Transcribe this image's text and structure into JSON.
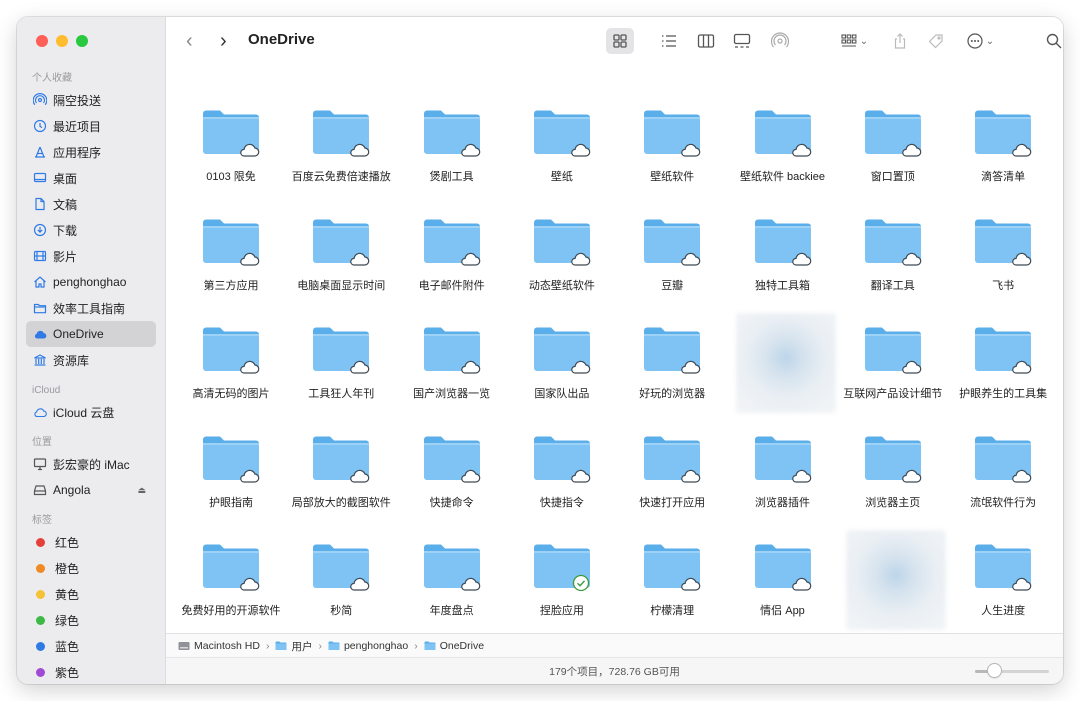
{
  "window": {
    "title": "OneDrive"
  },
  "sidebar": {
    "sections": [
      {
        "heading": "个人收藏",
        "items": [
          {
            "label": "隔空投送",
            "icon": "airdrop-icon"
          },
          {
            "label": "最近项目",
            "icon": "clock-icon"
          },
          {
            "label": "应用程序",
            "icon": "applications-icon"
          },
          {
            "label": "桌面",
            "icon": "desktop-icon"
          },
          {
            "label": "文稿",
            "icon": "document-icon"
          },
          {
            "label": "下载",
            "icon": "download-icon"
          },
          {
            "label": "影片",
            "icon": "film-icon"
          },
          {
            "label": "penghonghao",
            "icon": "home-icon"
          },
          {
            "label": "效率工具指南",
            "icon": "folder-icon"
          },
          {
            "label": "OneDrive",
            "icon": "cloud-icon",
            "selected": true
          },
          {
            "label": "资源库",
            "icon": "library-icon"
          }
        ]
      },
      {
        "heading": "iCloud",
        "items": [
          {
            "label": "iCloud 云盘",
            "icon": "icloud-icon"
          }
        ]
      },
      {
        "heading": "位置",
        "items": [
          {
            "label": "彭宏豪的 iMac",
            "icon": "imac-icon"
          },
          {
            "label": "Angola",
            "icon": "drive-icon",
            "eject": "⏏"
          }
        ]
      },
      {
        "heading": "标签",
        "items": [
          {
            "label": "红色",
            "color": "#e5413a"
          },
          {
            "label": "橙色",
            "color": "#f08a24"
          },
          {
            "label": "黄色",
            "color": "#f4c234"
          },
          {
            "label": "绿色",
            "color": "#3dba45"
          },
          {
            "label": "蓝色",
            "color": "#2f7ae5"
          },
          {
            "label": "紫色",
            "color": "#a04bd6"
          }
        ]
      }
    ]
  },
  "toolbar": {
    "back_glyph": "‹",
    "forward_glyph": "›",
    "buttons": [
      "icon-view-button",
      "list-view-button",
      "column-view-button",
      "gallery-view-button",
      "airdrop-button",
      "group-button",
      "share-button",
      "tag-button",
      "more-button",
      "search-button"
    ]
  },
  "items": [
    {
      "label": "0103 限免",
      "status": "cloud"
    },
    {
      "label": "百度云免费倍速播放",
      "status": "cloud"
    },
    {
      "label": "煲剧工具",
      "status": "cloud"
    },
    {
      "label": "壁纸",
      "status": "cloud"
    },
    {
      "label": "壁纸软件",
      "status": "cloud"
    },
    {
      "label": "壁纸软件 backiee",
      "status": "cloud"
    },
    {
      "label": "窗口置顶",
      "status": "cloud"
    },
    {
      "label": "滴答清单",
      "status": "cloud"
    },
    {
      "label": "第三方应用",
      "status": "cloud"
    },
    {
      "label": "电脑桌面显示时间",
      "status": "cloud"
    },
    {
      "label": "电子邮件附件",
      "status": "cloud"
    },
    {
      "label": "动态壁纸软件",
      "status": "cloud"
    },
    {
      "label": "豆瓣",
      "status": "cloud"
    },
    {
      "label": "独特工具箱",
      "status": "cloud"
    },
    {
      "label": "翻译工具",
      "status": "cloud"
    },
    {
      "label": "飞书",
      "status": "cloud"
    },
    {
      "label": "高清无码的图片",
      "status": "cloud"
    },
    {
      "label": "工具狂人年刊",
      "status": "cloud"
    },
    {
      "label": "国产浏览器一览",
      "status": "cloud"
    },
    {
      "label": "国家队出品",
      "status": "cloud"
    },
    {
      "label": "好玩的浏览器",
      "status": "cloud"
    },
    {
      "label": "",
      "status": "blurred"
    },
    {
      "label": "互联网产品设计细节",
      "status": "cloud"
    },
    {
      "label": "护眼养生的工具集",
      "status": "cloud"
    },
    {
      "label": "护眼指南",
      "status": "cloud"
    },
    {
      "label": "局部放大的截图软件",
      "status": "cloud"
    },
    {
      "label": "快捷命令",
      "status": "cloud"
    },
    {
      "label": "快捷指令",
      "status": "cloud"
    },
    {
      "label": "快速打开应用",
      "status": "cloud"
    },
    {
      "label": "浏览器插件",
      "status": "cloud"
    },
    {
      "label": "浏览器主页",
      "status": "cloud"
    },
    {
      "label": "流氓软件行为",
      "status": "cloud"
    },
    {
      "label": "免费好用的开源软件",
      "status": "cloud"
    },
    {
      "label": "秒简",
      "status": "cloud"
    },
    {
      "label": "年度盘点",
      "status": "cloud"
    },
    {
      "label": "捏脸应用",
      "status": "synced"
    },
    {
      "label": "柠檬清理",
      "status": "cloud"
    },
    {
      "label": "情侣 App",
      "status": "cloud"
    },
    {
      "label": "",
      "status": "blurred"
    },
    {
      "label": "人生进度",
      "status": "cloud"
    }
  ],
  "pathbar": {
    "segments": [
      "Macintosh HD",
      "用户",
      "penghonghao",
      "OneDrive"
    ],
    "separator": "›"
  },
  "statusbar": {
    "text": "179个项目，728.76 GB可用",
    "zoom_fraction": 0.25
  },
  "colors": {
    "folder": "#7ec3f3",
    "folder_tab": "#5aaeea",
    "accent": "#2f7ae5"
  }
}
